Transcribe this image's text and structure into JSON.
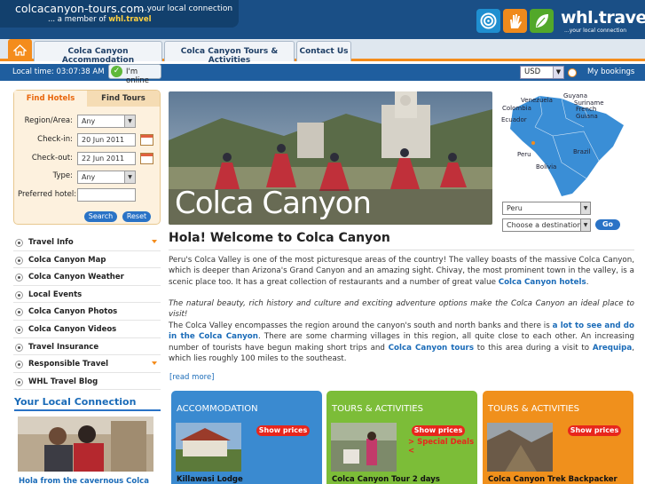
{
  "header": {
    "site_name": "colcacanyon-tours.com",
    "tagline": "...your local connection",
    "member_prefix": "... a member of",
    "member_brand": "whl.travel",
    "brand_logo_text": "whl.travel",
    "brand_logo_sub": "...your local connection"
  },
  "nav": {
    "tabs": [
      {
        "label": "Colca Canyon Accommodation"
      },
      {
        "label": "Colca Canyon Tours & Activities"
      },
      {
        "label": "Contact Us"
      }
    ]
  },
  "toolbar": {
    "local_time": "Local time: 03:07:38 AM",
    "online_label": "I'm online",
    "currency": "USD",
    "bookings_link": "My bookings"
  },
  "search": {
    "tab_hotels": "Find Hotels",
    "tab_tours": "Find Tours",
    "region_label": "Region/Area:",
    "region_value": "Any",
    "checkin_label": "Check-in:",
    "checkin_value": "20 Jun 2011",
    "checkout_label": "Check-out:",
    "checkout_value": "22 Jun 2011",
    "type_label": "Type:",
    "type_value": "Any",
    "preferred_label": "Preferred hotel:",
    "preferred_value": "",
    "search_btn": "Search",
    "reset_btn": "Reset"
  },
  "menu": {
    "items": [
      {
        "label": "Travel Info",
        "expand": true
      },
      {
        "label": "Colca Canyon Map",
        "expand": false
      },
      {
        "label": "Colca Canyon Weather",
        "expand": false
      },
      {
        "label": "Local Events",
        "expand": false
      },
      {
        "label": "Colca Canyon Photos",
        "expand": false
      },
      {
        "label": "Colca Canyon Videos",
        "expand": false
      },
      {
        "label": "Travel Insurance",
        "expand": false
      },
      {
        "label": "Responsible Travel",
        "expand": true
      },
      {
        "label": "WHL Travel Blog",
        "expand": false
      }
    ]
  },
  "local_connection": {
    "title": "Your Local Connection",
    "caption": "Hola from the cavernous Colca"
  },
  "hero": {
    "title": "Colca Canyon"
  },
  "map": {
    "labels": [
      "Venezuela",
      "Guyana",
      "Suriname",
      "French Guiana",
      "Colombia",
      "Ecuador",
      "Peru",
      "Brazil",
      "Bolivia"
    ],
    "country_select": "Peru",
    "destination_select": "Choose a destination",
    "go_btn": "Go"
  },
  "main": {
    "welcome": "Hola! Welcome to Colca Canyon",
    "p1_text": "Peru's Colca Valley is one of the most picturesque areas of the country! The valley boasts of the massive Colca Canyon, which is deeper than Arizona's Grand Canyon and an amazing sight. Chivay, the most prominent town in the valley, is a scenic place too. It has a great collection of restaurants and a number of great value",
    "p1_link": "Colca Canyon hotels",
    "p2_text": "The natural beauty, rich history and culture and exciting adventure options make the Colca Canyon an ideal place to visit!",
    "p3_a": "The Colca Valley encompasses the region around the canyon's south and north banks and there is",
    "p3_link1": "a lot to see and do in the Colca Canyon",
    "p3_b": ". There are some charming villages in this region, all quite close to each other. An increasing number of tourists have begun making short trips and",
    "p3_link2": "Colca Canyon tours",
    "p3_c": "to this area during a visit to",
    "p3_link3": "Arequipa",
    "p3_d": ", which lies roughly 100 miles to the southeast.",
    "read_more": "[read more]"
  },
  "cards": [
    {
      "title": "ACCOMMODATION",
      "btn": "Show prices",
      "special": "",
      "name": "Killawasi Lodge",
      "color": "#3a8ad0"
    },
    {
      "title": "TOURS & ACTIVITIES",
      "btn": "Show prices",
      "special": "> Special Deals <",
      "name": "Colca Canyon Tour 2 days",
      "color": "#7cbd38"
    },
    {
      "title": "TOURS & ACTIVITIES",
      "btn": "Show prices",
      "special": "",
      "name": "Colca Canyon Trek Backpacker",
      "color": "#f0901c"
    }
  ],
  "colors": {
    "header_bg": "#1a4f86",
    "accent_orange": "#f48c1c",
    "link_blue": "#1a6bb8",
    "cta_red": "#e8261c"
  }
}
